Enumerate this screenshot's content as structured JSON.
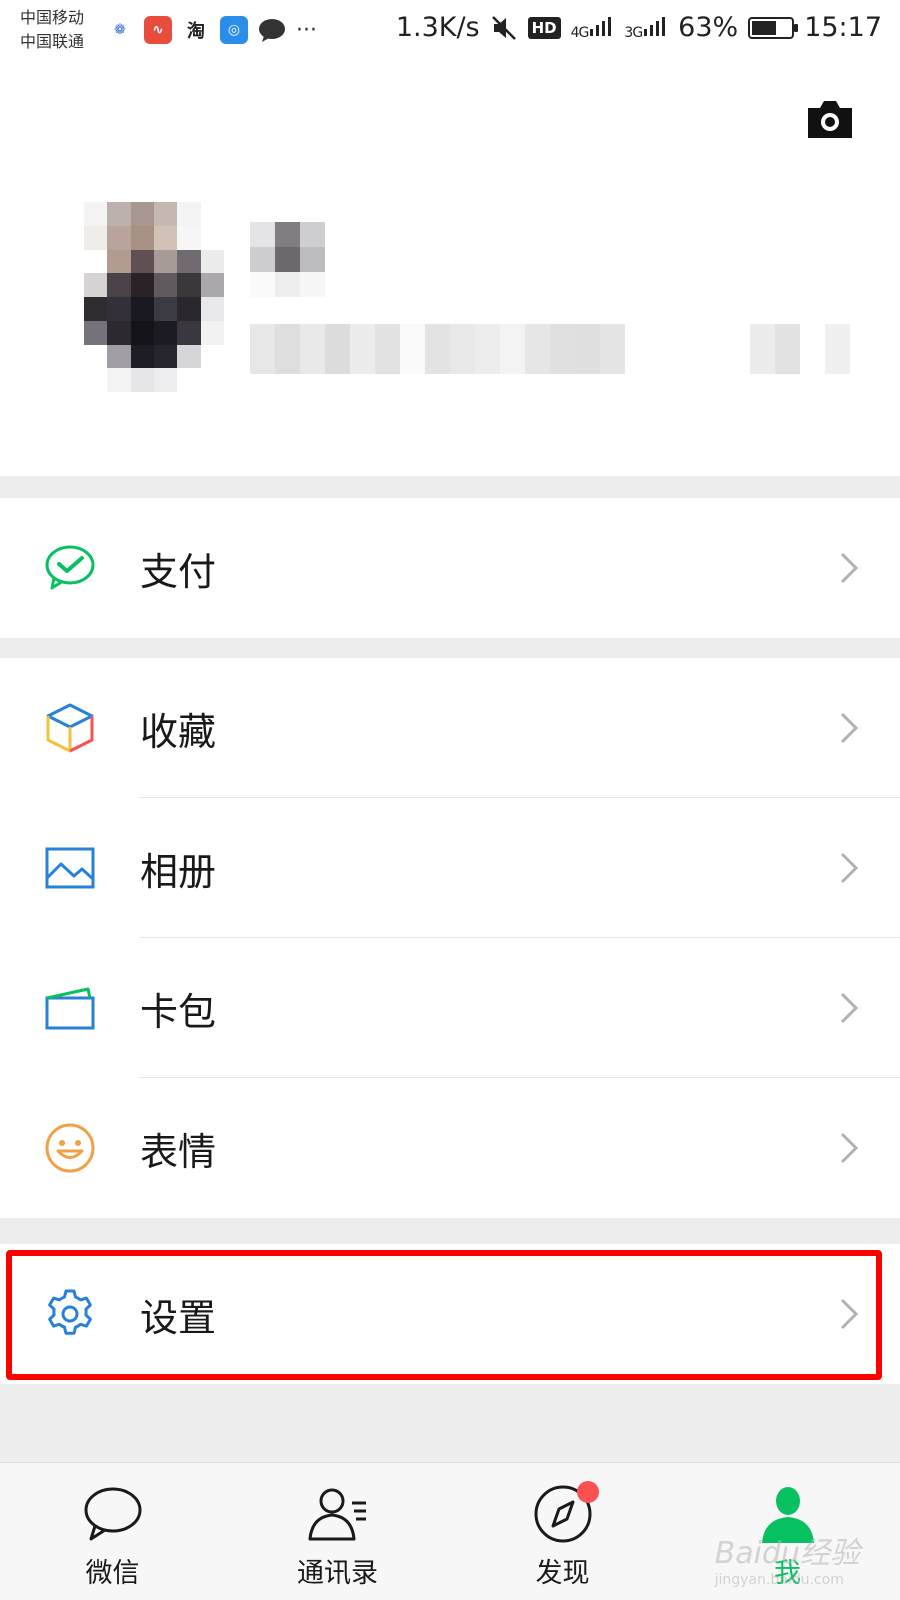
{
  "status_bar": {
    "carrier_1": "中国移动",
    "carrier_2": "中国联通",
    "app_icons": [
      "baidu-icon",
      "weibo-icon",
      "taobao-icon",
      "wifi-key-icon",
      "wechat-icon"
    ],
    "more": "···",
    "net_speed": "1.3K/s",
    "hd": "HD",
    "net_1": "4G",
    "net_2": "3G",
    "battery": "63%",
    "battery_level": 0.63,
    "time": "15:17"
  },
  "profile": {
    "camera_icon": "camera-icon"
  },
  "menu": {
    "pay": {
      "label": "支付",
      "icon": "wechat-pay-icon",
      "color": "#07c160"
    },
    "favorites": {
      "label": "收藏",
      "icon": "favorites-cube-icon"
    },
    "album": {
      "label": "相册",
      "icon": "album-icon",
      "color": "#2782d7"
    },
    "cards": {
      "label": "卡包",
      "icon": "card-wallet-icon",
      "color": "#2782d7"
    },
    "stickers": {
      "label": "表情",
      "icon": "sticker-smile-icon",
      "color": "#f0a146"
    },
    "settings": {
      "label": "设置",
      "icon": "gear-icon",
      "color": "#2782d7"
    }
  },
  "highlight_color": "#ff0000",
  "tabs": [
    {
      "label": "微信",
      "icon": "chat-bubble-icon"
    },
    {
      "label": "通讯录",
      "icon": "contacts-icon"
    },
    {
      "label": "发现",
      "icon": "compass-icon",
      "badge": true
    },
    {
      "label": "我",
      "icon": "me-person-icon",
      "active": true
    }
  ],
  "accent_color": "#07c160",
  "watermark": {
    "brand": "Baidu经验",
    "url": "jingyan.baidu.com"
  }
}
